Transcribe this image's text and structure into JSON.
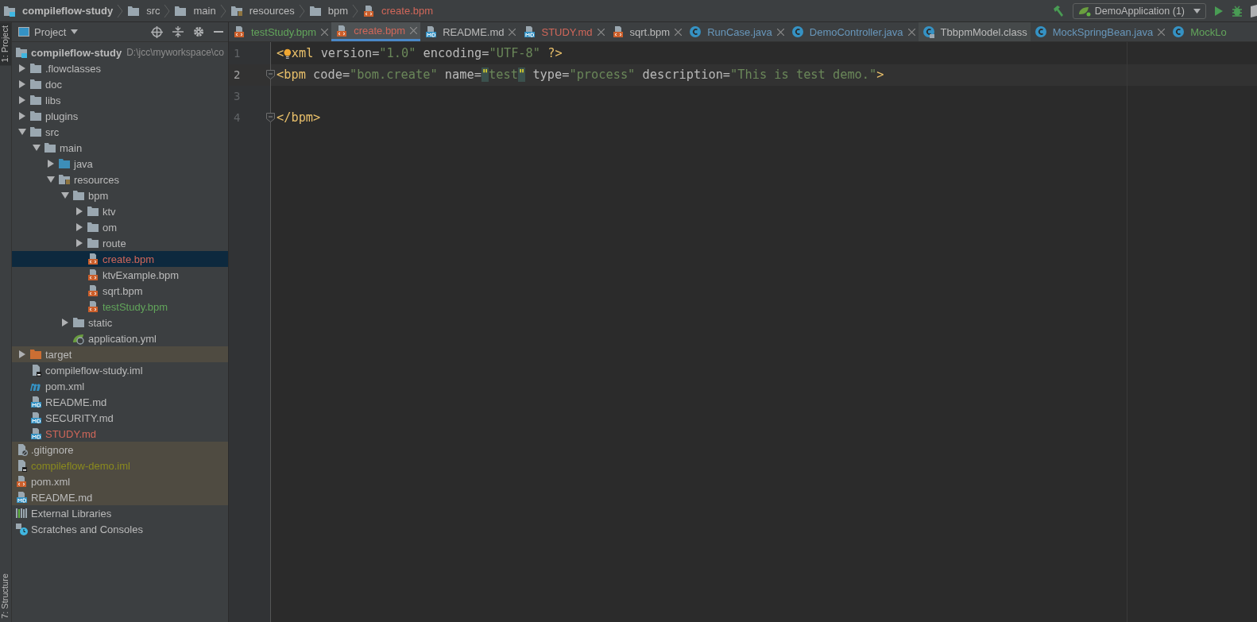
{
  "breadcrumbs": [
    {
      "label": "compileflow-study",
      "kind": "project"
    },
    {
      "label": "src",
      "kind": "folder"
    },
    {
      "label": "main",
      "kind": "folder"
    },
    {
      "label": "resources",
      "kind": "resources"
    },
    {
      "label": "bpm",
      "kind": "folder"
    },
    {
      "label": "create.bpm",
      "kind": "bpm",
      "color": "#d1675a"
    }
  ],
  "run_config": {
    "label": "DemoApplication (1)"
  },
  "side_strip": {
    "top": "1: Project",
    "bottom": "7: Structure"
  },
  "panel": {
    "title": "Project"
  },
  "tabs": [
    {
      "label": "testStudy.bpm",
      "kind": "bpm",
      "color": "#62a55b",
      "selected": false,
      "closable": true
    },
    {
      "label": "create.bpm",
      "kind": "bpm",
      "color": "#d1675a",
      "selected": true,
      "closable": true
    },
    {
      "label": "README.md",
      "kind": "md",
      "color": "#bbbbbb",
      "selected": false,
      "closable": true
    },
    {
      "label": "STUDY.md",
      "kind": "md",
      "color": "#d1675a",
      "selected": false,
      "closable": true
    },
    {
      "label": "sqrt.bpm",
      "kind": "bpm",
      "color": "#bbbbbb",
      "selected": false,
      "closable": true
    },
    {
      "label": "RunCase.java",
      "kind": "class",
      "color": "#6897bb",
      "selected": false,
      "closable": true
    },
    {
      "label": "DemoController.java",
      "kind": "class",
      "color": "#6897bb",
      "selected": false,
      "closable": true
    },
    {
      "label": "TbbpmModel.class",
      "kind": "readonly",
      "color": "#bbbbbb",
      "selected": false,
      "closable": false
    },
    {
      "label": "MockSpringBean.java",
      "kind": "class",
      "color": "#6897bb",
      "selected": false,
      "closable": true
    },
    {
      "label": "MockLo",
      "kind": "class",
      "color": "#62a55b",
      "selected": false,
      "closable": false
    }
  ],
  "tree": [
    {
      "label": "compileflow-study",
      "note": "D:\\jcc\\myworkspace\\co",
      "kind": "project",
      "color": "#bbbbbb",
      "selected": false,
      "ignored": false,
      "children": [
        {
          "label": ".flowclasses",
          "kind": "folder",
          "color": "#bbbbbb",
          "expanded": false,
          "selected": false,
          "ignored": false
        },
        {
          "label": "doc",
          "kind": "folder",
          "color": "#bbbbbb",
          "expanded": false,
          "selected": false,
          "ignored": false
        },
        {
          "label": "libs",
          "kind": "folder",
          "color": "#bbbbbb",
          "expanded": false,
          "selected": false,
          "ignored": false
        },
        {
          "label": "plugins",
          "kind": "folder",
          "color": "#bbbbbb",
          "expanded": false,
          "selected": false,
          "ignored": false
        },
        {
          "label": "src",
          "kind": "folder",
          "color": "#bbbbbb",
          "expanded": true,
          "selected": false,
          "ignored": false,
          "children": [
            {
              "label": "main",
              "kind": "folder",
              "color": "#bbbbbb",
              "expanded": true,
              "selected": false,
              "ignored": false,
              "children": [
                {
                  "label": "java",
                  "kind": "sources",
                  "color": "#bbbbbb",
                  "expanded": false,
                  "selected": false,
                  "ignored": false
                },
                {
                  "label": "resources",
                  "kind": "resources",
                  "color": "#bbbbbb",
                  "expanded": true,
                  "selected": false,
                  "ignored": false,
                  "children": [
                    {
                      "label": "bpm",
                      "kind": "folder",
                      "color": "#bbbbbb",
                      "expanded": true,
                      "selected": false,
                      "ignored": false,
                      "children": [
                        {
                          "label": "ktv",
                          "kind": "folder",
                          "color": "#bbbbbb",
                          "expanded": false,
                          "selected": false,
                          "ignored": false
                        },
                        {
                          "label": "om",
                          "kind": "folder",
                          "color": "#bbbbbb",
                          "expanded": false,
                          "selected": false,
                          "ignored": false
                        },
                        {
                          "label": "route",
                          "kind": "folder",
                          "color": "#bbbbbb",
                          "expanded": false,
                          "selected": false,
                          "ignored": false
                        },
                        {
                          "label": "create.bpm",
                          "kind": "bpm",
                          "color": "#d1675a",
                          "selected": true,
                          "ignored": false
                        },
                        {
                          "label": "ktvExample.bpm",
                          "kind": "bpm",
                          "color": "#bbbbbb",
                          "selected": false,
                          "ignored": false
                        },
                        {
                          "label": "sqrt.bpm",
                          "kind": "bpm",
                          "color": "#bbbbbb",
                          "selected": false,
                          "ignored": false
                        },
                        {
                          "label": "testStudy.bpm",
                          "kind": "bpm",
                          "color": "#62a55b",
                          "selected": false,
                          "ignored": false
                        }
                      ]
                    },
                    {
                      "label": "static",
                      "kind": "folder",
                      "color": "#bbbbbb",
                      "expanded": false,
                      "selected": false,
                      "ignored": false
                    },
                    {
                      "label": "application.yml",
                      "kind": "yml",
                      "color": "#bbbbbb",
                      "selected": false,
                      "ignored": false
                    }
                  ]
                }
              ]
            }
          ]
        },
        {
          "label": "target",
          "kind": "excluded",
          "color": "#bbbbbb",
          "expanded": false,
          "selected": false,
          "ignored": true
        },
        {
          "label": "compileflow-study.iml",
          "kind": "iml",
          "color": "#bbbbbb",
          "selected": false,
          "ignored": false
        },
        {
          "label": "pom.xml",
          "kind": "maven",
          "color": "#bbbbbb",
          "selected": false,
          "ignored": false
        },
        {
          "label": "README.md",
          "kind": "md",
          "color": "#bbbbbb",
          "selected": false,
          "ignored": false
        },
        {
          "label": "SECURITY.md",
          "kind": "md",
          "color": "#bbbbbb",
          "selected": false,
          "ignored": false
        },
        {
          "label": "STUDY.md",
          "kind": "md",
          "color": "#d1675a",
          "selected": false,
          "ignored": false
        }
      ]
    },
    {
      "label": ".gitignore",
      "kind": "gitignore",
      "color": "#bbbbbb",
      "selected": false,
      "ignored": true
    },
    {
      "label": "compileflow-demo.iml",
      "kind": "iml",
      "color": "#8a8a1e",
      "selected": false,
      "ignored": true
    },
    {
      "label": "pom.xml",
      "kind": "bpm",
      "color": "#bbbbbb",
      "selected": false,
      "ignored": true
    },
    {
      "label": "README.md",
      "kind": "md",
      "color": "#bbbbbb",
      "selected": false,
      "ignored": true
    },
    {
      "label": "External Libraries",
      "kind": "libraries",
      "color": "#bbbbbb",
      "selected": false,
      "ignored": false
    },
    {
      "label": "Scratches and Consoles",
      "kind": "scratches",
      "color": "#bbbbbb",
      "selected": false,
      "ignored": false
    }
  ],
  "editor": {
    "lines": [
      {
        "number": "1",
        "current": false,
        "fold": false,
        "tokens": [
          {
            "kind": "tag",
            "text": "<"
          },
          {
            "kind": "bulb"
          },
          {
            "kind": "tag",
            "text": "xml"
          },
          {
            "kind": "attr",
            "text": " version="
          },
          {
            "kind": "str",
            "text": "\"1.0\""
          },
          {
            "kind": "attr",
            "text": " encoding="
          },
          {
            "kind": "str",
            "text": "\"UTF-8\""
          },
          {
            "kind": "tag",
            "text": " ?>"
          }
        ]
      },
      {
        "number": "2",
        "current": true,
        "fold": true,
        "tokens": [
          {
            "kind": "tag",
            "text": "<bpm"
          },
          {
            "kind": "attr",
            "text": " code="
          },
          {
            "kind": "str",
            "text": "\"bom.create\""
          },
          {
            "kind": "attr",
            "text": " name="
          },
          {
            "kind": "match",
            "text": "\""
          },
          {
            "kind": "str",
            "text": "test"
          },
          {
            "kind": "match",
            "text": "\""
          },
          {
            "kind": "attr",
            "text": " type="
          },
          {
            "kind": "str",
            "text": "\"process\""
          },
          {
            "kind": "attr",
            "text": " description="
          },
          {
            "kind": "str",
            "text": "\"This is test demo.\""
          },
          {
            "kind": "tag",
            "text": ">"
          }
        ]
      },
      {
        "number": "3",
        "current": false,
        "fold": false
      },
      {
        "number": "4",
        "current": false,
        "fold": true,
        "tokens": [
          {
            "kind": "tag",
            "text": "</bpm>"
          }
        ]
      }
    ]
  }
}
